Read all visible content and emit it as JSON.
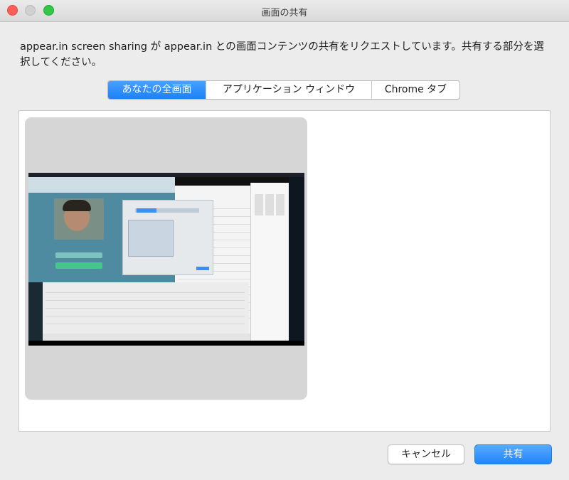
{
  "window": {
    "title": "画面の共有"
  },
  "description": "appear.in screen sharing が appear.in との画面コンテンツの共有をリクエストしています。共有する部分を選択してください。",
  "tabs": [
    {
      "label": "あなたの全画面",
      "selected": true
    },
    {
      "label": "アプリケーション ウィンドウ",
      "selected": false
    },
    {
      "label": "Chrome タブ",
      "selected": false
    }
  ],
  "buttons": {
    "cancel": "キャンセル",
    "share": "共有"
  },
  "colors": {
    "accent": "#1a82f7",
    "close": "#fc5f57",
    "maximize": "#33c748"
  }
}
